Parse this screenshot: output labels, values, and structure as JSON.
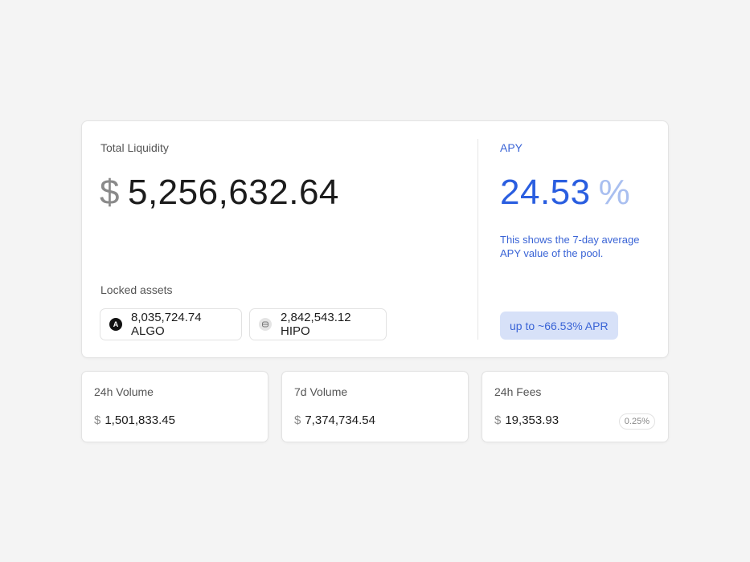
{
  "liquidity": {
    "label": "Total Liquidity",
    "currency": "$",
    "value": "5,256,632.64"
  },
  "locked": {
    "label": "Locked assets",
    "assets": [
      {
        "amount": "8,035,724.74 ALGO",
        "icon": "algo-icon",
        "glyph": "A"
      },
      {
        "amount": "2,842,543.12 HIPO",
        "icon": "hipo-icon",
        "glyph": "H"
      }
    ]
  },
  "apy": {
    "label": "APY",
    "value": "24.53",
    "unit": "%",
    "description": "This shows the 7-day average APY value of the pool.",
    "apr_badge": "up to ~66.53% APR"
  },
  "stats": [
    {
      "label": "24h Volume",
      "currency": "$",
      "value": "1,501,833.45"
    },
    {
      "label": "7d Volume",
      "currency": "$",
      "value": "7,374,734.54"
    },
    {
      "label": "24h Fees",
      "currency": "$",
      "value": "19,353.93",
      "badge": "0.25%"
    }
  ],
  "colors": {
    "accent": "#2a5ee0",
    "accent_light": "#d7e1f8",
    "background": "#f4f4f4"
  }
}
